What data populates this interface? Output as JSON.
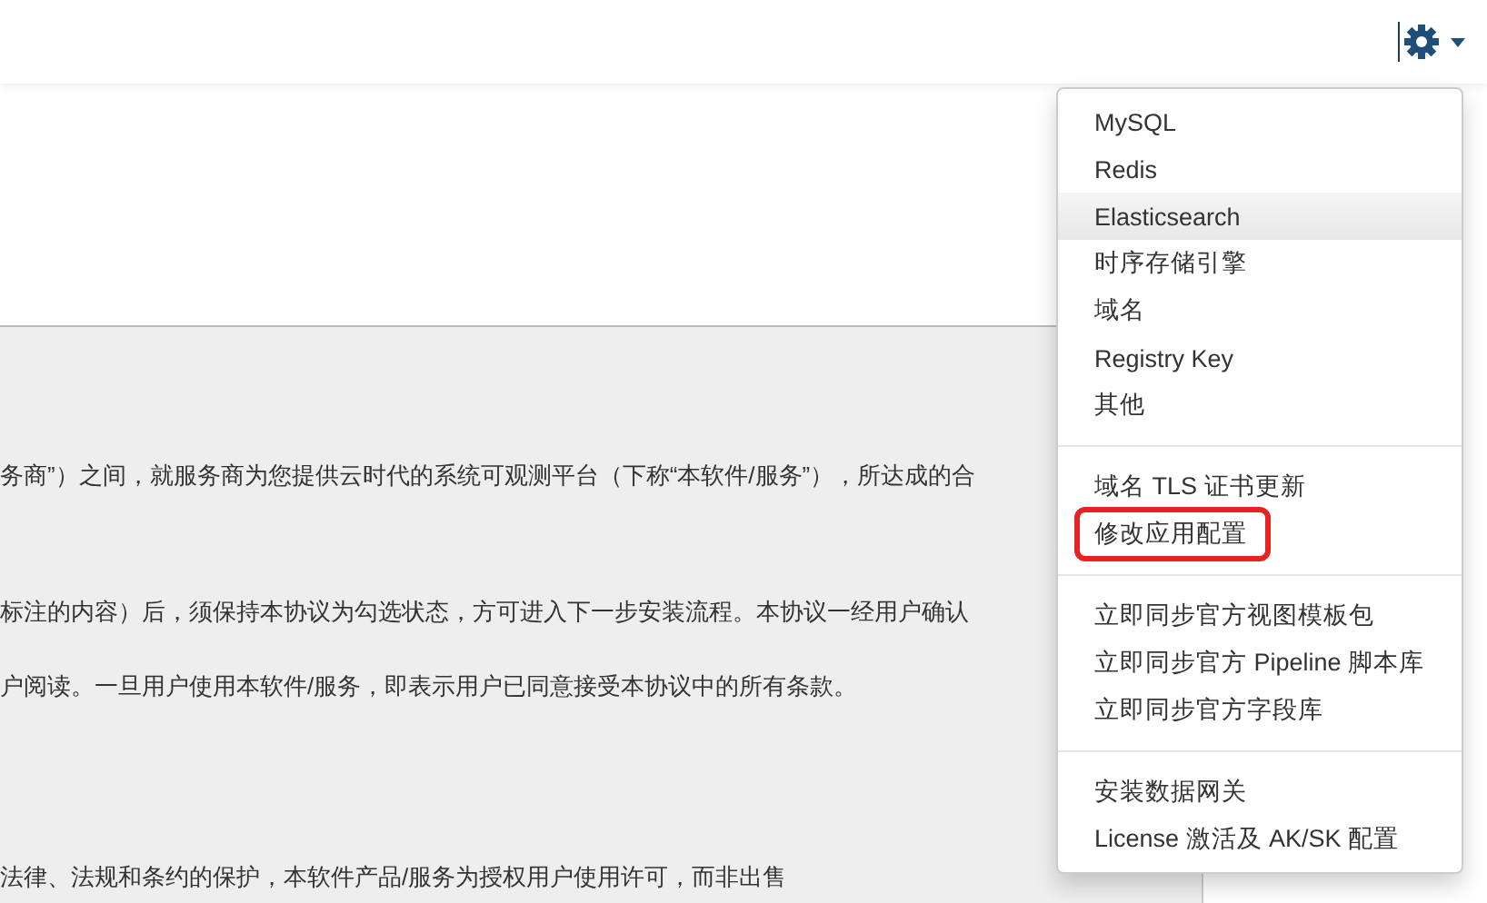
{
  "paragraphs": [
    "务商”）之间，就服务商为您提供云时代的系统可观测平台（下称“本软件/服务”），所达成的合",
    "标注的内容）后，须保持本协议为勾选状态，方可进入下一步安装流程。本协议一经用户确认",
    "户阅读。一旦用户使用本软件/服务，即表示用户已同意接受本协议中的所有条款。",
    "法律、法规和条约的保护，本软件产品/服务为授权用户使用许可，而非出售"
  ],
  "menu": {
    "groups": [
      [
        {
          "label": "MySQL",
          "selected": false,
          "highlighted": false
        },
        {
          "label": "Redis",
          "selected": false,
          "highlighted": false
        },
        {
          "label": "Elasticsearch",
          "selected": true,
          "highlighted": false
        },
        {
          "label": "时序存储引擎",
          "selected": false,
          "highlighted": false
        },
        {
          "label": "域名",
          "selected": false,
          "highlighted": false
        },
        {
          "label": "Registry Key",
          "selected": false,
          "highlighted": false
        },
        {
          "label": "其他",
          "selected": false,
          "highlighted": false
        }
      ],
      [
        {
          "label": "域名 TLS 证书更新",
          "selected": false,
          "highlighted": false
        },
        {
          "label": "修改应用配置",
          "selected": false,
          "highlighted": true
        }
      ],
      [
        {
          "label": "立即同步官方视图模板包",
          "selected": false,
          "highlighted": false
        },
        {
          "label": "立即同步官方 Pipeline 脚本库",
          "selected": false,
          "highlighted": false
        },
        {
          "label": "立即同步官方字段库",
          "selected": false,
          "highlighted": false
        }
      ],
      [
        {
          "label": "安装数据网关",
          "selected": false,
          "highlighted": false
        },
        {
          "label": "License 激活及 AK/SK 配置",
          "selected": false,
          "highlighted": false
        }
      ]
    ]
  }
}
